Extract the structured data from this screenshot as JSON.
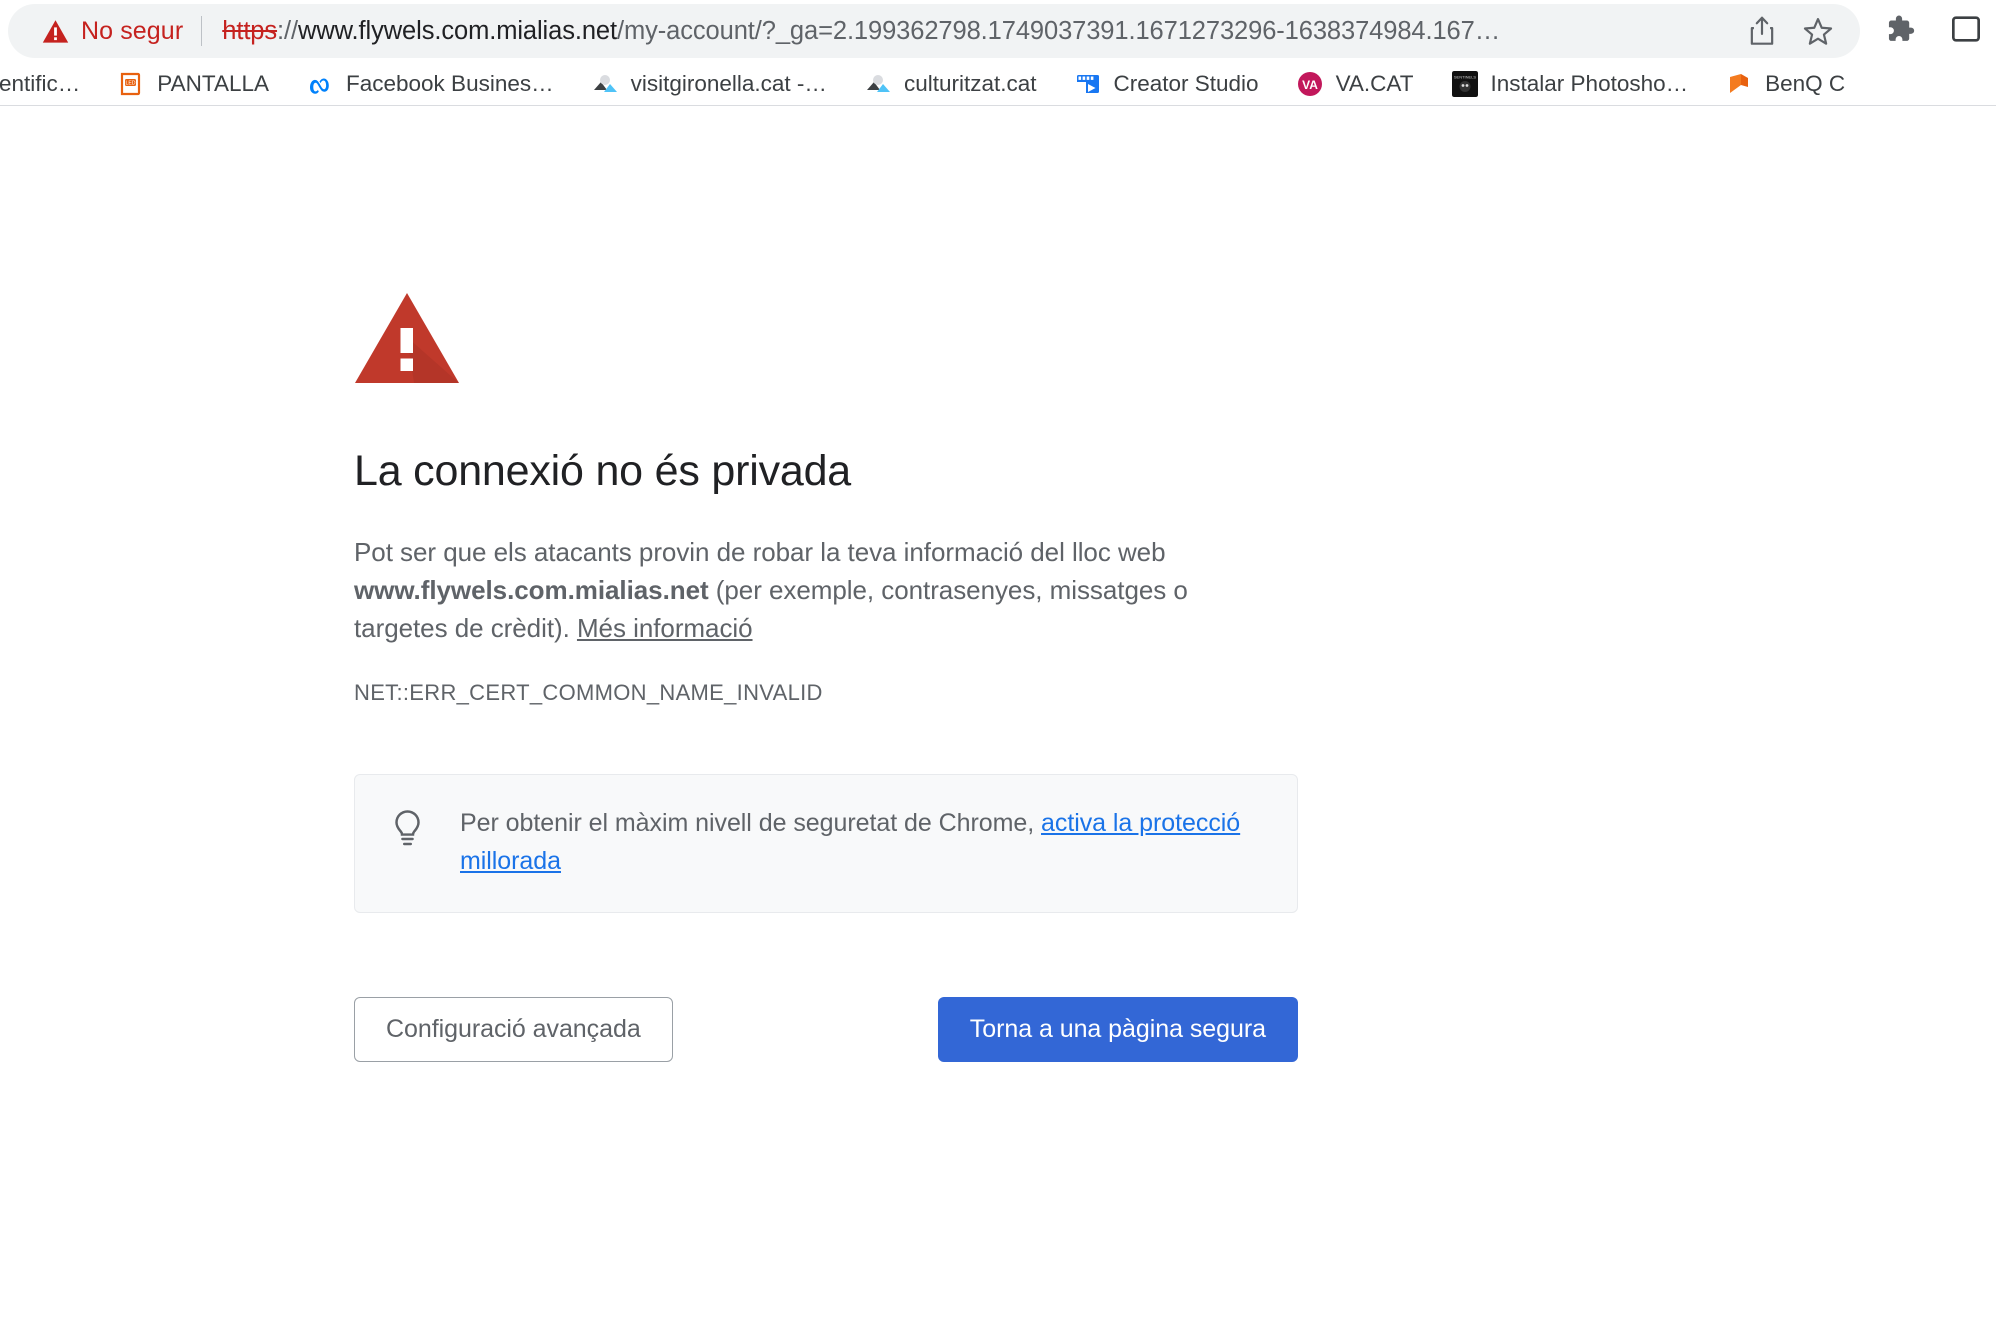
{
  "browser": {
    "omnibox": {
      "security_label": "No segur",
      "security_icon": "warning-triangle-icon",
      "url_scheme": "https",
      "url_separator": "://",
      "url_host": "www.flywels.com.mialias.net",
      "url_path": "/my-account/?_ga=2.199362798.1749037391.1671273296-1638374984.167…",
      "share_icon": "share-icon",
      "bookmark_icon": "star-icon"
    },
    "right_icons": {
      "extensions_icon": "puzzle-piece-icon",
      "sidepanel_icon": "side-panel-icon"
    },
    "bookmarks": [
      {
        "label": "entific…",
        "icon": "generic-favicon"
      },
      {
        "label": "PANTALLA",
        "icon": "led-pantalla-favicon"
      },
      {
        "label": "Facebook Busines…",
        "icon": "meta-favicon"
      },
      {
        "label": "visitgironella.cat -…",
        "icon": "photo-favicon"
      },
      {
        "label": "culturitzat.cat",
        "icon": "photo-favicon"
      },
      {
        "label": "Creator Studio",
        "icon": "creator-studio-favicon"
      },
      {
        "label": "VA.CAT",
        "icon": "va-cat-favicon"
      },
      {
        "label": "Instalar Photosho…",
        "icon": "sentinels-favicon"
      },
      {
        "label": "BenQ C",
        "icon": "benq-favicon"
      }
    ]
  },
  "interstitial": {
    "icon": "warning-triangle-icon",
    "title": "La connexió no és privada",
    "body_part1": "Pot ser que els atacants provin de robar la teva informació del lloc web ",
    "body_host": "www.flywels.com.mialias.net",
    "body_part2": " (per exemple, contrasenyes, missatges o targetes de crèdit). ",
    "more_info_link": "Més informació",
    "error_code": "NET::ERR_CERT_COMMON_NAME_INVALID",
    "enhanced_protection": {
      "icon": "lightbulb-icon",
      "text": "Per obtenir el màxim nivell de seguretat de Chrome, ",
      "link": "activa la protecció millorada"
    },
    "advanced_button": "Configuració avançada",
    "back_to_safety_button": "Torna a una pàgina segura"
  },
  "colors": {
    "danger_red": "#c5221f",
    "triangle_red": "#c0392b",
    "link_blue": "#1a73e8",
    "button_blue": "#3367d6",
    "text_gray": "#5f6368",
    "heading_dark": "#202124",
    "omnibox_bg": "#f1f3f4",
    "panel_bg": "#f8f9fa"
  }
}
